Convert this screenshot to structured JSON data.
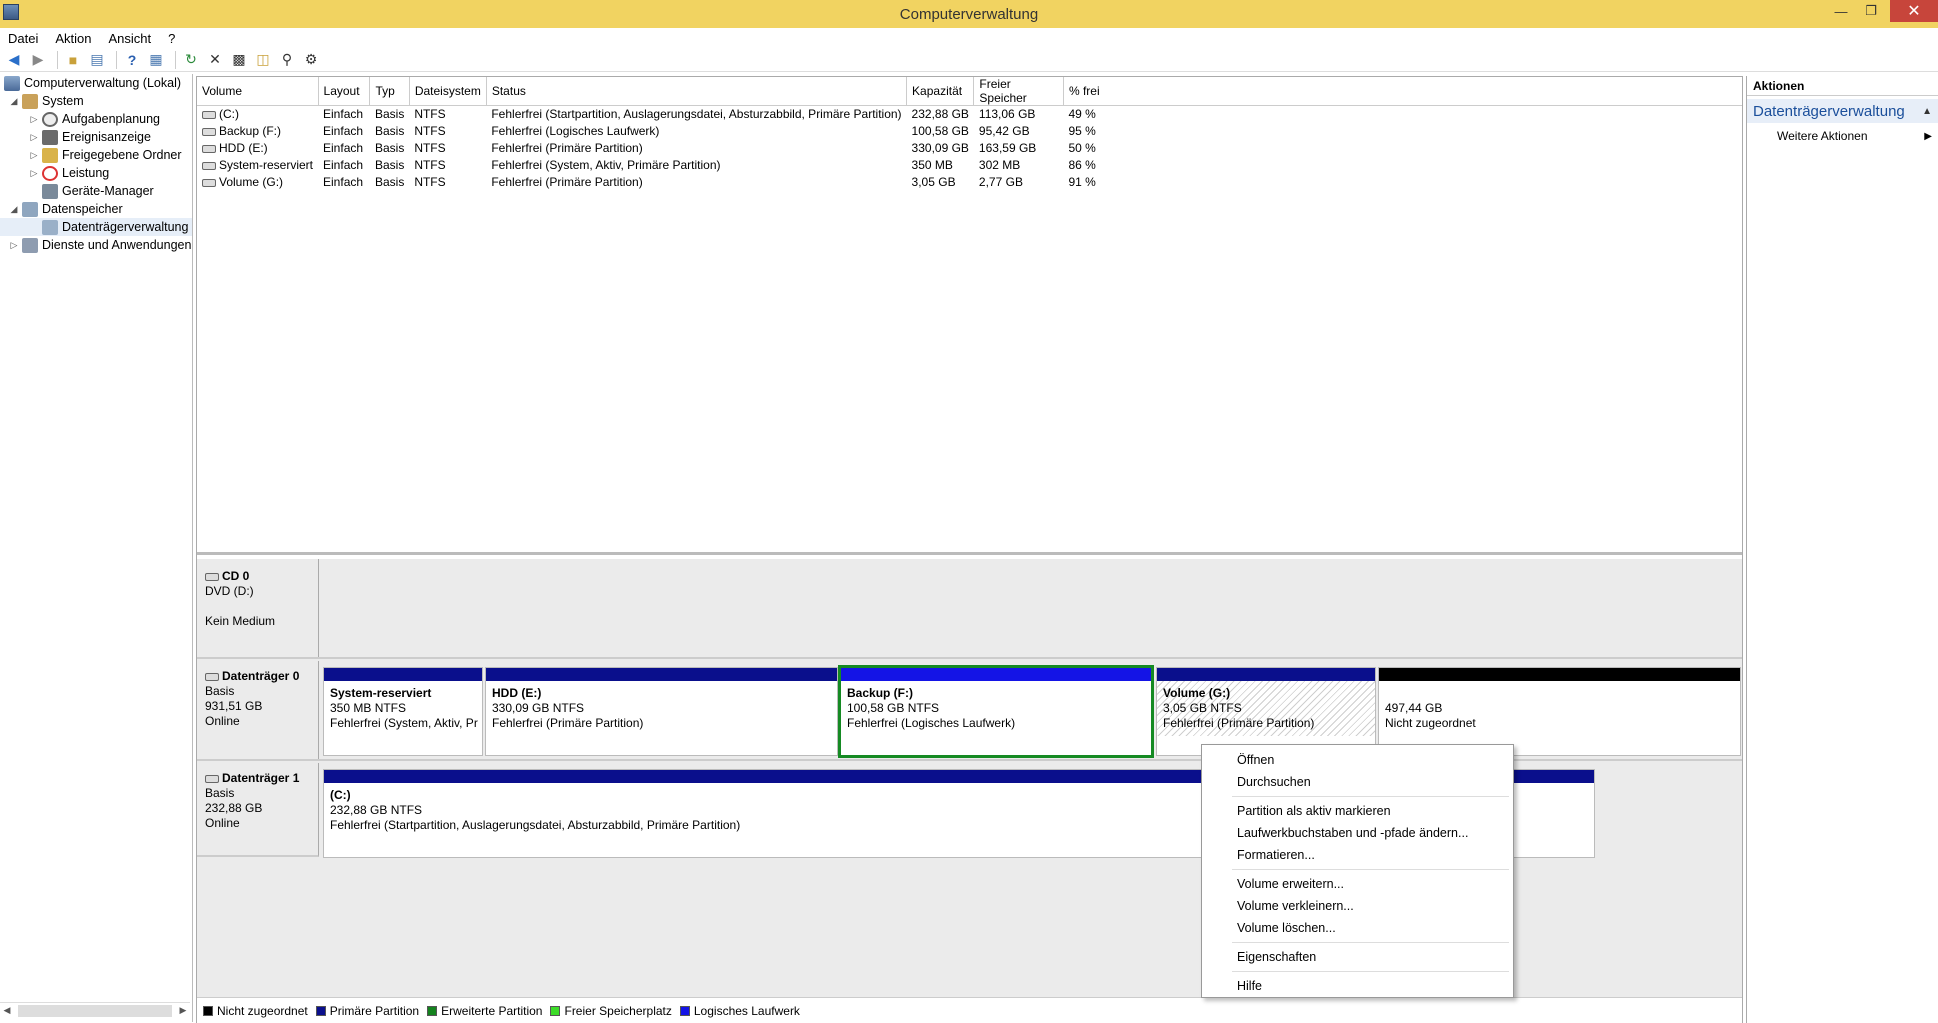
{
  "window": {
    "title": "Computerverwaltung"
  },
  "menu": [
    "Datei",
    "Aktion",
    "Ansicht",
    "?"
  ],
  "tree": {
    "root": "Computerverwaltung (Lokal)",
    "system": "System",
    "system_items": [
      "Aufgabenplanung",
      "Ereignisanzeige",
      "Freigegebene Ordner",
      "Leistung",
      "Geräte-Manager"
    ],
    "storage": "Datenspeicher",
    "storage_items": [
      "Datenträgerverwaltung"
    ],
    "services": "Dienste und Anwendungen"
  },
  "volume_table": {
    "headers": [
      "Volume",
      "Layout",
      "Typ",
      "Dateisystem",
      "Status",
      "Kapazität",
      "Freier Speicher",
      "% frei"
    ],
    "rows": [
      [
        "(C:)",
        "Einfach",
        "Basis",
        "NTFS",
        "Fehlerfrei (Startpartition, Auslagerungsdatei, Absturzabbild, Primäre Partition)",
        "232,88 GB",
        "113,06 GB",
        "49 %"
      ],
      [
        "Backup (F:)",
        "Einfach",
        "Basis",
        "NTFS",
        "Fehlerfrei (Logisches Laufwerk)",
        "100,58 GB",
        "95,42 GB",
        "95 %"
      ],
      [
        "HDD (E:)",
        "Einfach",
        "Basis",
        "NTFS",
        "Fehlerfrei (Primäre Partition)",
        "330,09 GB",
        "163,59 GB",
        "50 %"
      ],
      [
        "System-reserviert",
        "Einfach",
        "Basis",
        "NTFS",
        "Fehlerfrei (System, Aktiv, Primäre Partition)",
        "350 MB",
        "302 MB",
        "86 %"
      ],
      [
        "Volume (G:)",
        "Einfach",
        "Basis",
        "NTFS",
        "Fehlerfrei (Primäre Partition)",
        "3,05 GB",
        "2,77 GB",
        "91 %"
      ]
    ]
  },
  "disks": {
    "cd0": {
      "name": "CD 0",
      "line1": "DVD (D:)",
      "line2": "",
      "line3": "Kein Medium"
    },
    "disk0": {
      "name": "Datenträger 0",
      "line1": "Basis",
      "line2": "931,51 GB",
      "line3": "Online",
      "partitions": [
        {
          "name": "System-reserviert",
          "size": "350 MB NTFS",
          "status": "Fehlerfrei (System, Aktiv, Pr"
        },
        {
          "name": "HDD  (E:)",
          "size": "330,09 GB NTFS",
          "status": "Fehlerfrei (Primäre Partition)"
        },
        {
          "name": "Backup  (F:)",
          "size": "100,58 GB NTFS",
          "status": "Fehlerfrei (Logisches Laufwerk)"
        },
        {
          "name": "Volume  (G:)",
          "size": "3,05 GB NTFS",
          "status": "Fehlerfrei (Primäre Partition)"
        },
        {
          "name": "",
          "size": "497,44 GB",
          "status": "Nicht zugeordnet"
        }
      ]
    },
    "disk1": {
      "name": "Datenträger 1",
      "line1": "Basis",
      "line2": "232,88 GB",
      "line3": "Online",
      "partitions": [
        {
          "name": "(C:)",
          "size": "232,88 GB NTFS",
          "status": "Fehlerfrei (Startpartition, Auslagerungsdatei, Absturzabbild, Primäre Partition)"
        }
      ]
    }
  },
  "legend": [
    "Nicht zugeordnet",
    "Primäre Partition",
    "Erweiterte Partition",
    "Freier Speicherplatz",
    "Logisches Laufwerk"
  ],
  "legend_colors": [
    "#000000",
    "#0a0f8c",
    "#14821e",
    "#3cdc28",
    "#1414e6"
  ],
  "actions": {
    "header": "Aktionen",
    "section": "Datenträgerverwaltung",
    "item": "Weitere Aktionen"
  },
  "context_menu": {
    "items": [
      "Öffnen",
      "Durchsuchen",
      "Partition als aktiv markieren",
      "Laufwerkbuchstaben und -pfade ändern...",
      "Formatieren...",
      "Volume erweitern...",
      "Volume verkleinern...",
      "Volume löschen...",
      "Eigenschaften",
      "Hilfe"
    ]
  },
  "colors": {
    "titlebar": "#f1d361",
    "close": "#c7453b",
    "selected_border": "#158a23"
  }
}
